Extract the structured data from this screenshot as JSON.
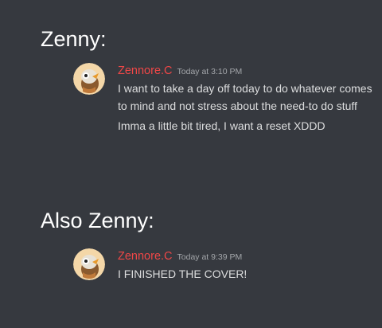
{
  "headings": {
    "first": "Zenny:",
    "second": "Also Zenny:"
  },
  "colors": {
    "background": "#36393f",
    "username": "#f04747",
    "message_text": "#dcddde",
    "timestamp": "#a3a6aa"
  },
  "messages": [
    {
      "username": "Zennore.C",
      "timestamp": "Today at 3:10 PM",
      "avatar": "owl-avatar-icon",
      "lines": [
        "I want to take a day off today to do whatever comes to mind and not stress about the need-to do stuff",
        "Imma a little bit tired, I want a reset XDDD"
      ]
    },
    {
      "username": "Zennore.C",
      "timestamp": "Today at 9:39 PM",
      "avatar": "owl-avatar-icon",
      "lines": [
        "I FINISHED THE COVER!"
      ]
    }
  ]
}
